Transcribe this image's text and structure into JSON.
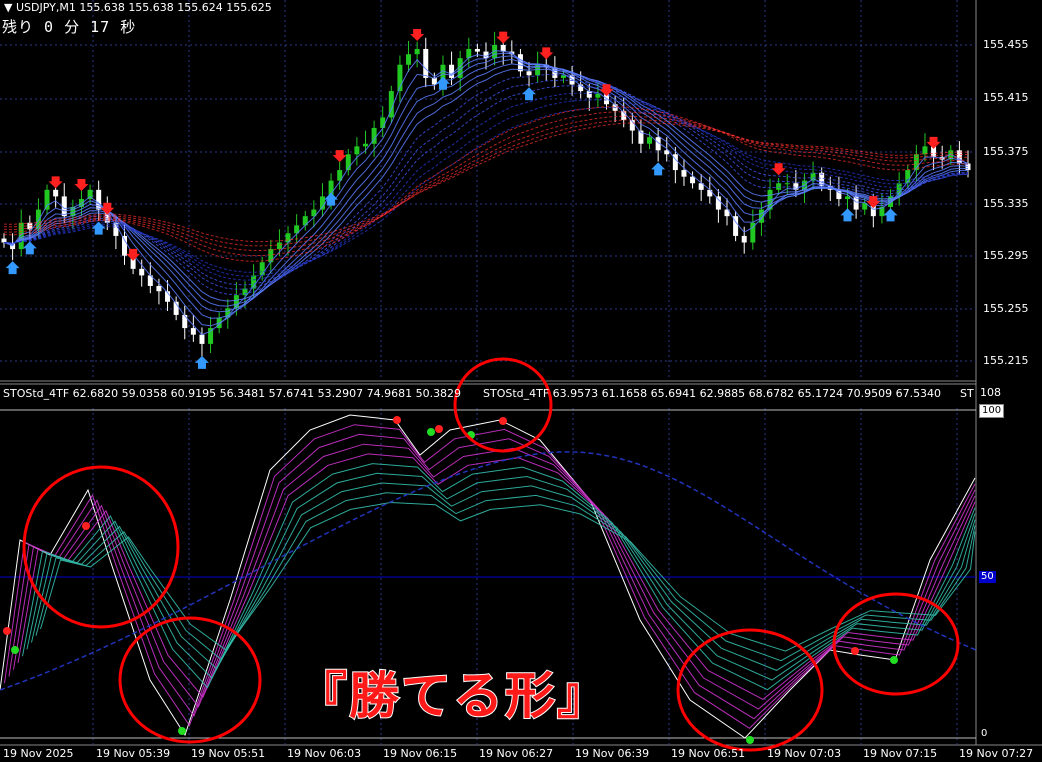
{
  "header": {
    "symbol": "USDJPY,M1",
    "ohlc": "155.638 155.638 155.624 155.625",
    "countdown": "残り 0 分 17 秒"
  },
  "indicator": {
    "header_left": "STOStd_4TF 62.6820 59.0358 60.9195 56.3481 57.6741 53.2907 74.9681 50.3829",
    "header_right": "STOStd_4TF 63.9573 61.1658 65.6941 62.9885 68.6782 65.1724 70.9509 67.5340",
    "header_tail": "ST",
    "scale_max": "108",
    "level_100": "100",
    "level_50": "50",
    "level_0": "0"
  },
  "price_axis": [
    "155.455",
    "155.415",
    "155.375",
    "155.335",
    "155.295",
    "155.255",
    "155.215"
  ],
  "time_axis": [
    "19 Nov 2025",
    "19 Nov 05:39",
    "19 Nov 05:51",
    "19 Nov 06:03",
    "19 Nov 06:15",
    "19 Nov 06:27",
    "19 Nov 06:39",
    "19 Nov 06:51",
    "19 Nov 07:03",
    "19 Nov 07:15",
    "19 Nov 07:27"
  ],
  "overlay": {
    "caption": "『勝てる形』"
  },
  "colors": {
    "background": "#000000",
    "bull_candle": "#22c822",
    "bear_candle": "#ffffff",
    "up_arrow": "#3399ff",
    "down_arrow": "#ff2020",
    "ribbon_blue": "#4466ff",
    "ribbon_red": "#ff3030",
    "stoch_magenta": "#cc33cc",
    "stoch_teal": "#33bbaa",
    "circle": "#ff0000",
    "level50": "#0000cc"
  },
  "chart_data": {
    "type": "candlestick",
    "series": [
      {
        "name": "USDJPY,M1",
        "closes": [
          155.305,
          155.3,
          155.32,
          155.315,
          155.33,
          155.345,
          155.34,
          155.325,
          155.332,
          155.338,
          155.345,
          155.33,
          155.32,
          155.31,
          155.295,
          155.285,
          155.28,
          155.272,
          155.268,
          155.26,
          155.25,
          155.24,
          155.235,
          155.228,
          155.24,
          155.248,
          155.255,
          155.265,
          155.27,
          155.28,
          155.29,
          155.3,
          155.305,
          155.312,
          155.318,
          155.325,
          155.33,
          155.34,
          155.352,
          155.36,
          155.372,
          155.378,
          155.38,
          155.392,
          155.4,
          155.42,
          155.44,
          155.448,
          155.452,
          155.43,
          155.425,
          155.44,
          155.43,
          155.445,
          155.452,
          155.45,
          155.445,
          155.455,
          155.45,
          155.448,
          155.435,
          155.432,
          155.44,
          155.438,
          155.43,
          155.432,
          155.425,
          155.42,
          155.415,
          155.418,
          155.41,
          155.405,
          155.398,
          155.39,
          155.38,
          155.385,
          155.375,
          155.372,
          155.36,
          155.355,
          155.35,
          155.345,
          155.34,
          155.33,
          155.325,
          155.31,
          155.305,
          155.32,
          155.33,
          155.345,
          155.35,
          155.35,
          155.345,
          155.352,
          155.358,
          155.348,
          155.345,
          155.338,
          155.34,
          155.33,
          155.335,
          155.325,
          155.332,
          155.34,
          155.35,
          155.36,
          155.372,
          155.378,
          155.37,
          155.368,
          155.375,
          155.365,
          155.36
        ]
      }
    ]
  }
}
